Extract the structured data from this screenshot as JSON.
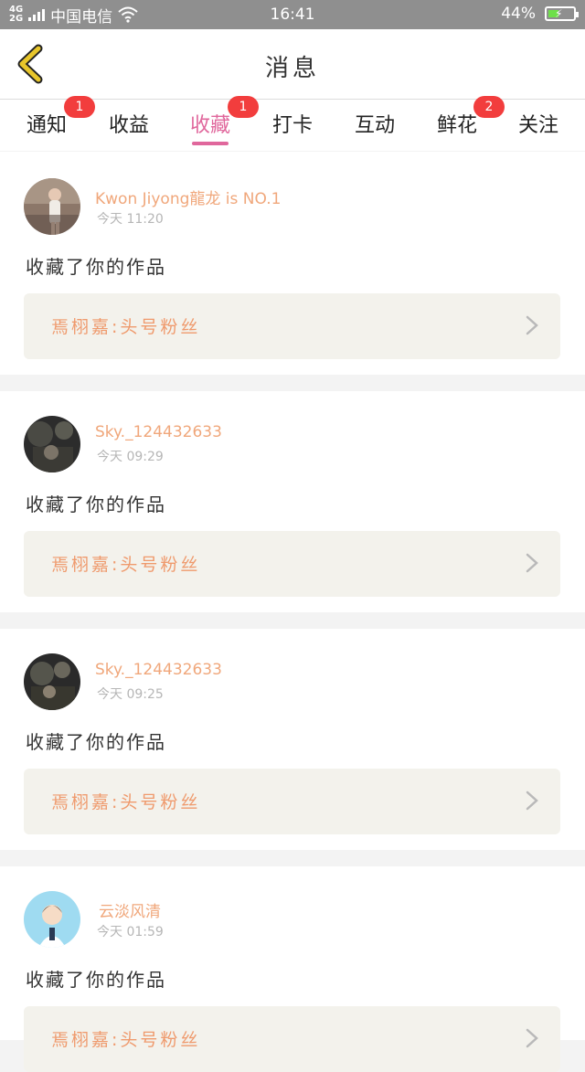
{
  "status_bar": {
    "carrier": "中国电信",
    "network_top": "4G",
    "network_bottom": "2G",
    "time": "16:41",
    "battery": "44%",
    "battery_level": 0.44
  },
  "header": {
    "title": "消息"
  },
  "tabs": [
    {
      "label": "通知",
      "badge": "1",
      "active": false
    },
    {
      "label": "收益",
      "badge": "",
      "active": false
    },
    {
      "label": "收藏",
      "badge": "1",
      "active": true
    },
    {
      "label": "打卡",
      "badge": "",
      "active": false
    },
    {
      "label": "互动",
      "badge": "",
      "active": false
    },
    {
      "label": "鲜花",
      "badge": "2",
      "active": false
    },
    {
      "label": "关注",
      "badge": "",
      "active": false
    }
  ],
  "messages": [
    {
      "user": "Kwon Jiyong龍龙 is NO.1",
      "time": "今天  11:20",
      "action": "收藏了你的作品",
      "work": "焉栩嘉:头号粉丝"
    },
    {
      "user": "Sky._124432633",
      "time": "今天  09:29",
      "action": "收藏了你的作品",
      "work": "焉栩嘉:头号粉丝"
    },
    {
      "user": "Sky._124432633",
      "time": "今天  09:25",
      "action": "收藏了你的作品",
      "work": "焉栩嘉:头号粉丝"
    },
    {
      "user": "云淡风清",
      "time": "今天  01:59",
      "action": "收藏了你的作品",
      "work": "焉栩嘉:头号粉丝"
    }
  ],
  "colors": {
    "accent": "#e0679c",
    "badge": "#f23d3d",
    "username": "#f0a77b",
    "back_icon": "#e8c62b"
  }
}
